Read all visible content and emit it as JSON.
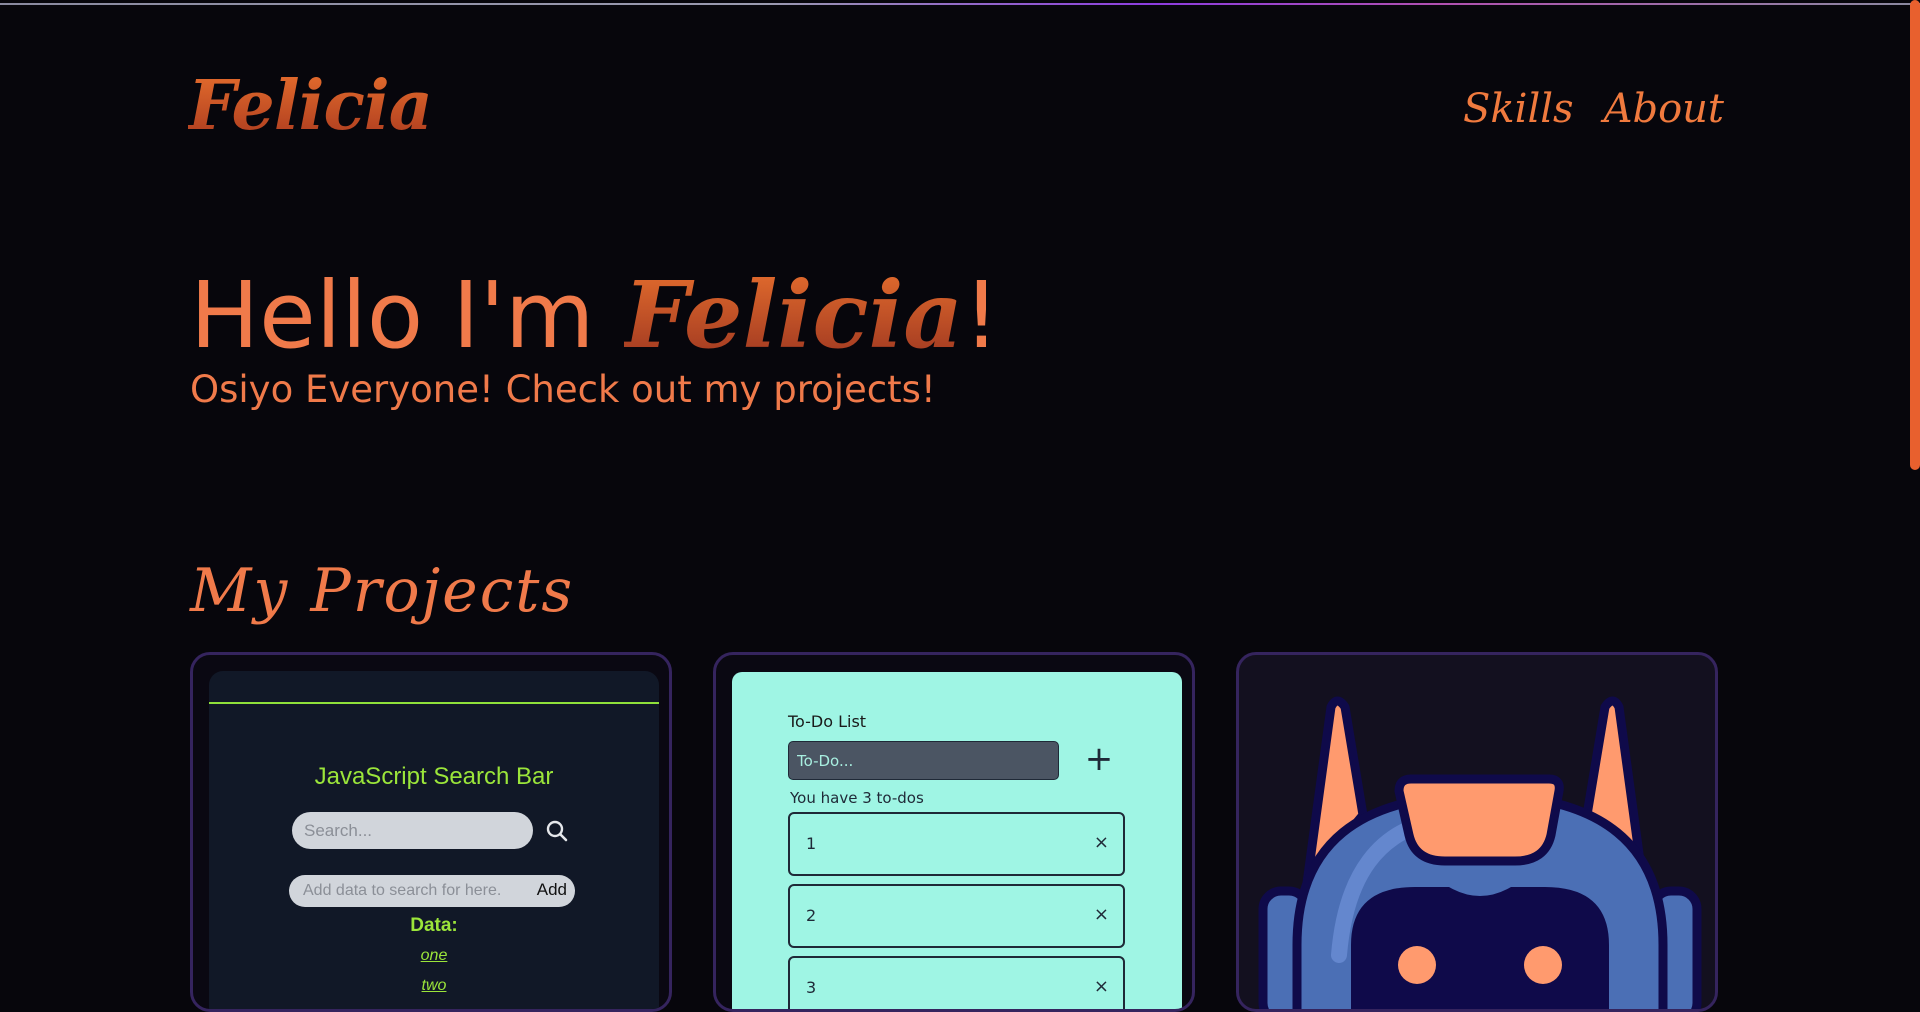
{
  "brand": {
    "logo": "Felicia"
  },
  "nav": {
    "items": [
      "Skills",
      "About"
    ]
  },
  "hero": {
    "greeting": "Hello I'm ",
    "name": "Felicia",
    "exclaim": "!",
    "subtitle": "Osiyo Everyone! Check out my projects!"
  },
  "projects": {
    "heading": "My Projects",
    "search_bar": {
      "title": "JavaScript Search Bar",
      "search_placeholder": "Search...",
      "add_placeholder": "Add data to search for here.",
      "add_label": "Add",
      "data_label": "Data:",
      "items": [
        "one",
        "two"
      ]
    },
    "todo": {
      "title": "To-Do List",
      "input_placeholder": "To-Do...",
      "add_symbol": "+",
      "count_text": "You have 3 to-dos",
      "items": [
        "1",
        "2",
        "3"
      ],
      "remove_symbol": "×"
    }
  },
  "colors": {
    "background": "#07060c",
    "accent": "#f07a4a",
    "card_border": "#35245e",
    "search_accent": "#9be53a",
    "todo_bg": "#9ff5e4",
    "robot_blue": "#4b6fb5",
    "robot_orange": "#ff9a6e"
  },
  "icons": {
    "search": "search-icon",
    "robot": "robot-mascot-icon"
  }
}
